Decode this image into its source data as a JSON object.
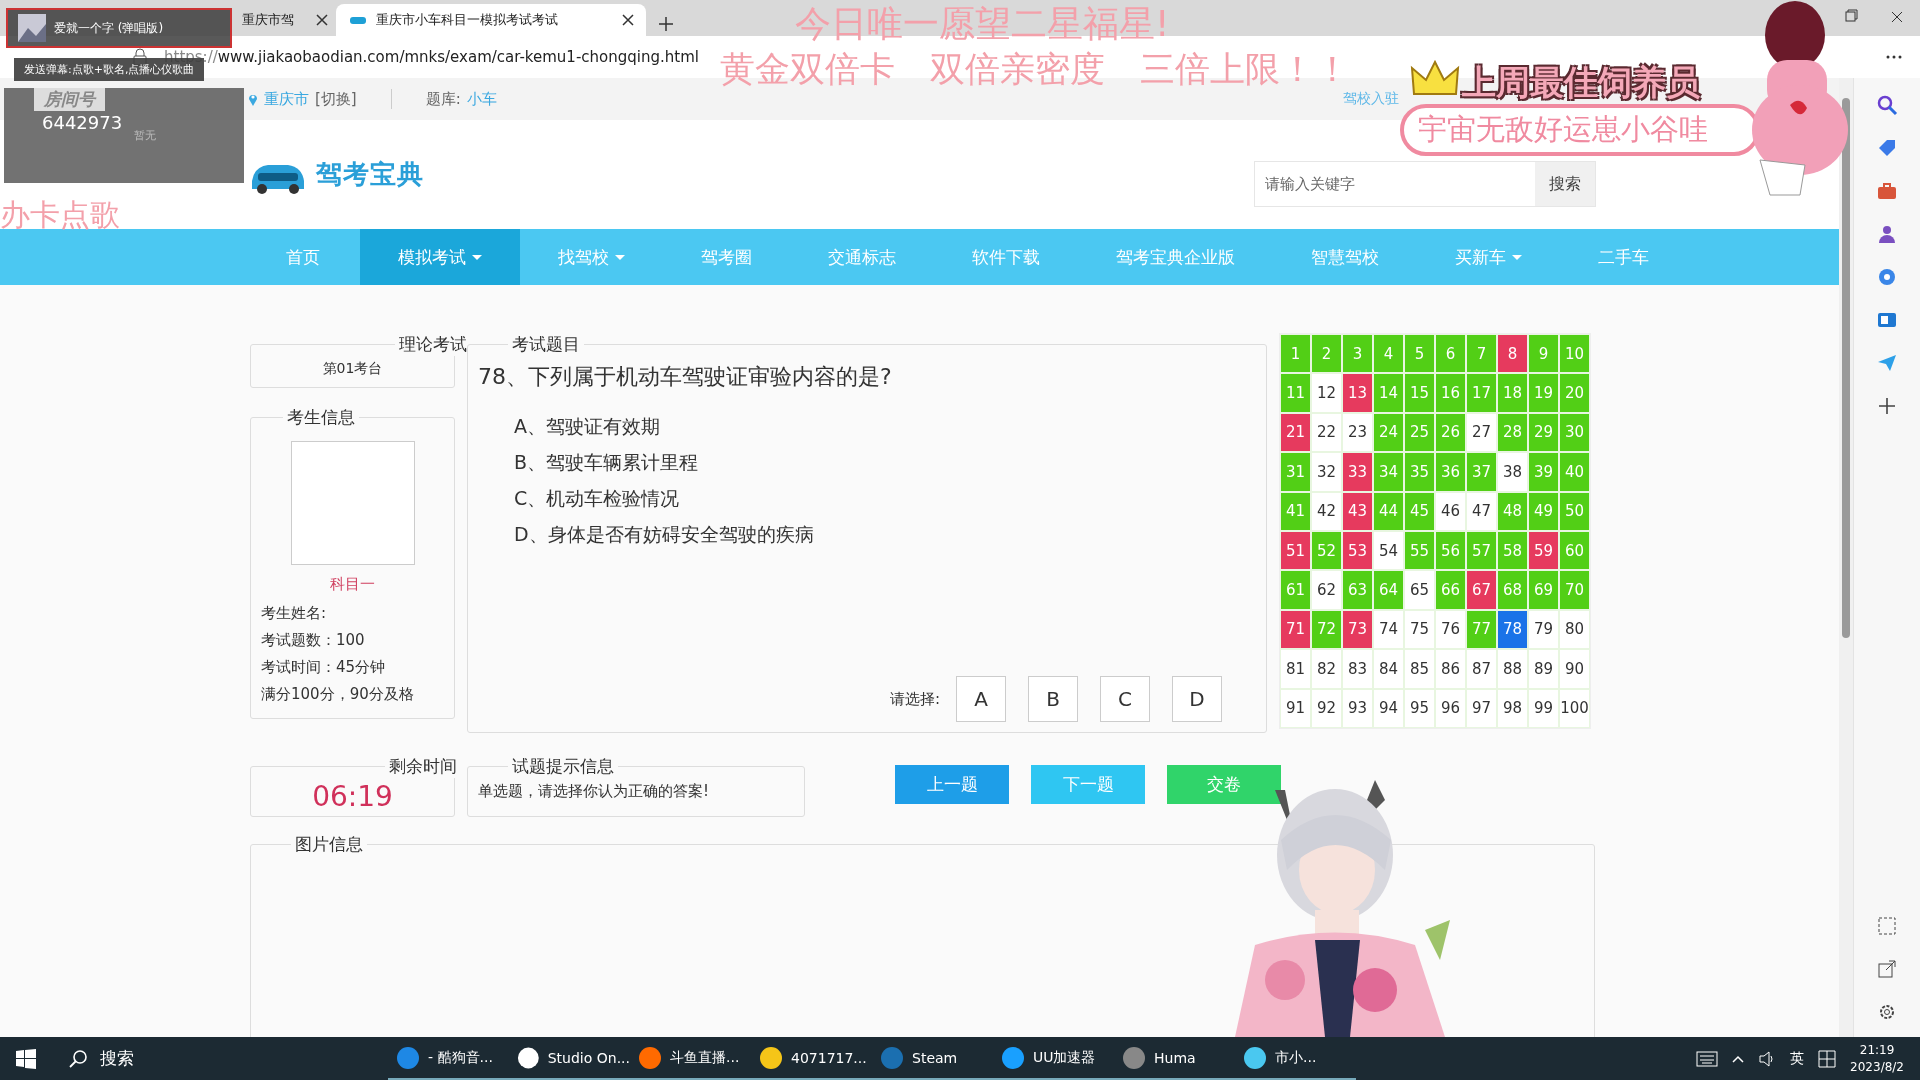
{
  "browser": {
    "tabs": [
      {
        "label": "重庆市驾",
        "selected": false
      },
      {
        "label": "重庆市小车科目一模拟考试考试",
        "selected": true
      }
    ],
    "address": {
      "scheme": "https://",
      "url": "www.jiakaobaodian.com/mnks/exam/car-kemu1-chongqing.html"
    }
  },
  "site": {
    "city": "重庆市",
    "switch": "[切换]",
    "bank_label": "题库:",
    "bank": "小车",
    "top_links": [
      "驾校入驻"
    ],
    "logo": "驾考宝典",
    "search": {
      "placeholder": "请输入关键字",
      "button": "搜索"
    },
    "nav": [
      {
        "label": "首页",
        "selected": false,
        "dropdown": false
      },
      {
        "label": "模拟考试",
        "selected": true,
        "dropdown": true
      },
      {
        "label": "找驾校",
        "selected": false,
        "dropdown": true
      },
      {
        "label": "驾考圈",
        "selected": false,
        "dropdown": false
      },
      {
        "label": "交通标志",
        "selected": false,
        "dropdown": false
      },
      {
        "label": "软件下载",
        "selected": false,
        "dropdown": false
      },
      {
        "label": "驾考宝典企业版",
        "selected": false,
        "dropdown": false
      },
      {
        "label": "智慧驾校",
        "selected": false,
        "dropdown": false
      },
      {
        "label": "买新车",
        "selected": false,
        "dropdown": true
      },
      {
        "label": "二手车",
        "selected": false,
        "dropdown": false
      }
    ]
  },
  "exam": {
    "seat": {
      "title": "理论考试",
      "value": "第01考台"
    },
    "candidate": {
      "title": "考生信息",
      "subject": "科目一",
      "lines": [
        "考生姓名:",
        "考试题数：100",
        "考试时间：45分钟",
        "满分100分，90分及格"
      ]
    },
    "question": {
      "title": "考试题目",
      "text": "78、下列属于机动车驾驶证审验内容的是?",
      "options": [
        "A、驾驶证有效期",
        "B、驾驶车辆累计里程",
        "C、机动车检验情况",
        "D、身体是否有妨碍安全驾驶的疾病"
      ],
      "choose_label": "请选择:",
      "choices": [
        "A",
        "B",
        "C",
        "D"
      ]
    },
    "grid": [
      {
        "number": "1",
        "kind": "correct"
      },
      {
        "number": "2",
        "kind": "correct"
      },
      {
        "number": "3",
        "kind": "correct"
      },
      {
        "number": "4",
        "kind": "correct"
      },
      {
        "number": "5",
        "kind": "correct"
      },
      {
        "number": "6",
        "kind": "correct"
      },
      {
        "number": "7",
        "kind": "correct"
      },
      {
        "number": "8",
        "kind": "wrong"
      },
      {
        "number": "9",
        "kind": "correct"
      },
      {
        "number": "10",
        "kind": "correct"
      },
      {
        "number": "11",
        "kind": "correct"
      },
      {
        "number": "12",
        "kind": "unanswered"
      },
      {
        "number": "13",
        "kind": "wrong"
      },
      {
        "number": "14",
        "kind": "correct"
      },
      {
        "number": "15",
        "kind": "correct"
      },
      {
        "number": "16",
        "kind": "correct"
      },
      {
        "number": "17",
        "kind": "correct"
      },
      {
        "number": "18",
        "kind": "correct"
      },
      {
        "number": "19",
        "kind": "correct"
      },
      {
        "number": "20",
        "kind": "correct"
      },
      {
        "number": "21",
        "kind": "wrong"
      },
      {
        "number": "22",
        "kind": "unanswered"
      },
      {
        "number": "23",
        "kind": "unanswered"
      },
      {
        "number": "24",
        "kind": "correct"
      },
      {
        "number": "25",
        "kind": "correct"
      },
      {
        "number": "26",
        "kind": "correct"
      },
      {
        "number": "27",
        "kind": "unanswered"
      },
      {
        "number": "28",
        "kind": "correct"
      },
      {
        "number": "29",
        "kind": "correct"
      },
      {
        "number": "30",
        "kind": "correct"
      },
      {
        "number": "31",
        "kind": "correct"
      },
      {
        "number": "32",
        "kind": "unanswered"
      },
      {
        "number": "33",
        "kind": "wrong"
      },
      {
        "number": "34",
        "kind": "correct"
      },
      {
        "number": "35",
        "kind": "correct"
      },
      {
        "number": "36",
        "kind": "correct"
      },
      {
        "number": "37",
        "kind": "correct"
      },
      {
        "number": "38",
        "kind": "unanswered"
      },
      {
        "number": "39",
        "kind": "correct"
      },
      {
        "number": "40",
        "kind": "correct"
      },
      {
        "number": "41",
        "kind": "correct"
      },
      {
        "number": "42",
        "kind": "unanswered"
      },
      {
        "number": "43",
        "kind": "wrong"
      },
      {
        "number": "44",
        "kind": "correct"
      },
      {
        "number": "45",
        "kind": "correct"
      },
      {
        "number": "46",
        "kind": "unanswered"
      },
      {
        "number": "47",
        "kind": "unanswered"
      },
      {
        "number": "48",
        "kind": "correct"
      },
      {
        "number": "49",
        "kind": "correct"
      },
      {
        "number": "50",
        "kind": "correct"
      },
      {
        "number": "51",
        "kind": "wrong"
      },
      {
        "number": "52",
        "kind": "correct"
      },
      {
        "number": "53",
        "kind": "wrong"
      },
      {
        "number": "54",
        "kind": "unanswered"
      },
      {
        "number": "55",
        "kind": "correct"
      },
      {
        "number": "56",
        "kind": "correct"
      },
      {
        "number": "57",
        "kind": "correct"
      },
      {
        "number": "58",
        "kind": "correct"
      },
      {
        "number": "59",
        "kind": "wrong"
      },
      {
        "number": "60",
        "kind": "correct"
      },
      {
        "number": "61",
        "kind": "correct"
      },
      {
        "number": "62",
        "kind": "unanswered"
      },
      {
        "number": "63",
        "kind": "correct"
      },
      {
        "number": "64",
        "kind": "correct"
      },
      {
        "number": "65",
        "kind": "unanswered"
      },
      {
        "number": "66",
        "kind": "correct"
      },
      {
        "number": "67",
        "kind": "wrong"
      },
      {
        "number": "68",
        "kind": "correct"
      },
      {
        "number": "69",
        "kind": "correct"
      },
      {
        "number": "70",
        "kind": "correct"
      },
      {
        "number": "71",
        "kind": "wrong"
      },
      {
        "number": "72",
        "kind": "correct"
      },
      {
        "number": "73",
        "kind": "wrong"
      },
      {
        "number": "74",
        "kind": "unanswered"
      },
      {
        "number": "75",
        "kind": "unanswered"
      },
      {
        "number": "76",
        "kind": "unanswered"
      },
      {
        "number": "77",
        "kind": "correct"
      },
      {
        "number": "78",
        "kind": "current"
      },
      {
        "number": "79",
        "kind": "unanswered"
      },
      {
        "number": "80",
        "kind": "unanswered"
      },
      {
        "number": "81",
        "kind": "unanswered"
      },
      {
        "number": "82",
        "kind": "unanswered"
      },
      {
        "number": "83",
        "kind": "unanswered"
      },
      {
        "number": "84",
        "kind": "unanswered"
      },
      {
        "number": "85",
        "kind": "unanswered"
      },
      {
        "number": "86",
        "kind": "unanswered"
      },
      {
        "number": "87",
        "kind": "unanswered"
      },
      {
        "number": "88",
        "kind": "unanswered"
      },
      {
        "number": "89",
        "kind": "unanswered"
      },
      {
        "number": "90",
        "kind": "unanswered"
      },
      {
        "number": "91",
        "kind": "unanswered"
      },
      {
        "number": "92",
        "kind": "unanswered"
      },
      {
        "number": "93",
        "kind": "unanswered"
      },
      {
        "number": "94",
        "kind": "unanswered"
      },
      {
        "number": "95",
        "kind": "unanswered"
      },
      {
        "number": "96",
        "kind": "unanswered"
      },
      {
        "number": "97",
        "kind": "unanswered"
      },
      {
        "number": "98",
        "kind": "unanswered"
      },
      {
        "number": "99",
        "kind": "unanswered"
      },
      {
        "number": "100",
        "kind": "unanswered"
      }
    ],
    "timer": {
      "title": "剩余时间",
      "value": "06:19"
    },
    "hint": {
      "title": "试题提示信息",
      "text": "单选题，请选择你认为正确的答案!"
    },
    "buttons": [
      {
        "label": "上一题",
        "kind": "prev"
      },
      {
        "label": "下一题",
        "kind": "next"
      },
      {
        "label": "交卷",
        "kind": "submit"
      }
    ],
    "image_panel": {
      "title": "图片信息"
    }
  },
  "overlay": {
    "song": "爱就一个字 (弹唱版)",
    "banner": "发送弹幕:点歌+歌名,点播心仪歌曲",
    "room_label": "房间号",
    "room_number": "6442973",
    "room_note": "暂无",
    "side_text": "办卡点歌",
    "promo": [
      "今日唯一愿望二星福星!",
      "黄金双倍卡　双倍亲密度　三倍上限！！"
    ],
    "award_title": "上周最佳饲养员",
    "award_name": "宇宙无敌好运崽小谷哇"
  },
  "taskbar": {
    "search": "搜索",
    "apps": [
      {
        "label": "- 酷狗音...",
        "color": "#1e88e5"
      },
      {
        "label": "Studio On...",
        "color": "#ffffff"
      },
      {
        "label": "斗鱼直播...",
        "color": "#ff6a00"
      },
      {
        "label": "4071717...",
        "color": "#f5c518"
      },
      {
        "label": "Steam",
        "color": "#1b6fb0"
      },
      {
        "label": "UU加速器",
        "color": "#19a0ff"
      },
      {
        "label": "Huma",
        "color": "#888888"
      },
      {
        "label": "市小...",
        "color": "#4ac8f0"
      }
    ],
    "ime": "英",
    "time": "21:19",
    "date": "2023/8/2"
  }
}
